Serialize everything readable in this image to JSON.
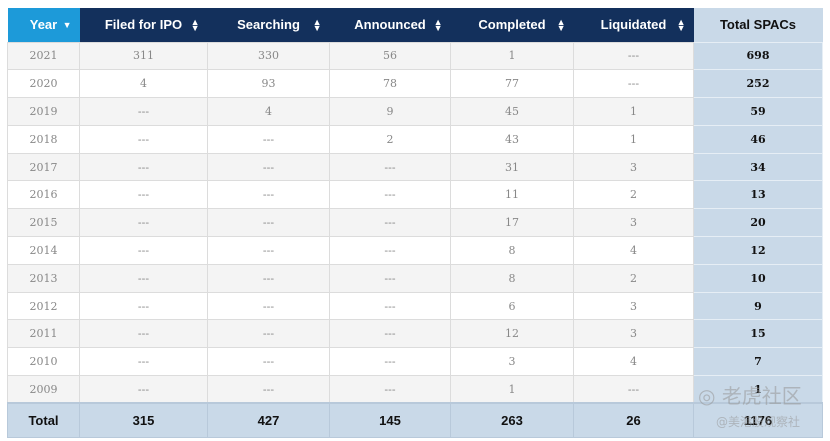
{
  "headers": [
    "Year",
    "Filed for IPO",
    "Searching",
    "Announced",
    "Completed",
    "Liquidated",
    "Total SPACs"
  ],
  "sort_icons": {
    "year": "caret-down-icon",
    "others": "sort-updown-icon"
  },
  "rows": [
    [
      "2021",
      "311",
      "330",
      "56",
      "1",
      "---",
      "698"
    ],
    [
      "2020",
      "4",
      "93",
      "78",
      "77",
      "---",
      "252"
    ],
    [
      "2019",
      "---",
      "4",
      "9",
      "45",
      "1",
      "59"
    ],
    [
      "2018",
      "---",
      "---",
      "2",
      "43",
      "1",
      "46"
    ],
    [
      "2017",
      "---",
      "---",
      "---",
      "31",
      "3",
      "34"
    ],
    [
      "2016",
      "---",
      "---",
      "---",
      "11",
      "2",
      "13"
    ],
    [
      "2015",
      "---",
      "---",
      "---",
      "17",
      "3",
      "20"
    ],
    [
      "2014",
      "---",
      "---",
      "---",
      "8",
      "4",
      "12"
    ],
    [
      "2013",
      "---",
      "---",
      "---",
      "8",
      "2",
      "10"
    ],
    [
      "2012",
      "---",
      "---",
      "---",
      "6",
      "3",
      "9"
    ],
    [
      "2011",
      "---",
      "---",
      "---",
      "12",
      "3",
      "15"
    ],
    [
      "2010",
      "---",
      "---",
      "---",
      "3",
      "4",
      "7"
    ],
    [
      "2009",
      "---",
      "---",
      "---",
      "1",
      "---",
      "1"
    ]
  ],
  "footer": [
    "Total",
    "315",
    "427",
    "145",
    "263",
    "26",
    "1176"
  ],
  "watermark": {
    "logo": "老虎社区",
    "handle": "@美港股观察社"
  },
  "colors": {
    "header": "#13305c",
    "year_header": "#1d9ad9",
    "total_col": "#c9d9e8"
  }
}
